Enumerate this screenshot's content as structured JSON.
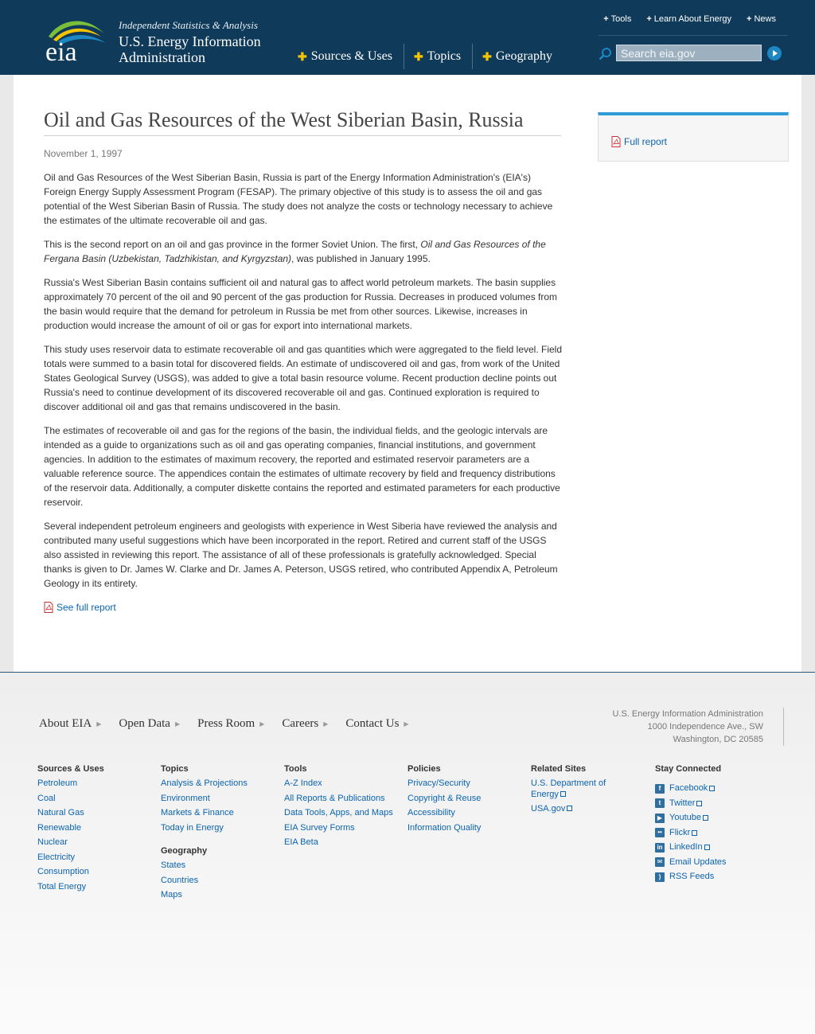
{
  "header": {
    "tagline": "Independent Statistics & Analysis",
    "org_name": "U.S. Energy Information Administration",
    "logo_text": "eia",
    "main_nav": [
      "Sources & Uses",
      "Topics",
      "Geography"
    ],
    "util_nav": [
      "Tools",
      "Learn About Energy",
      "News"
    ],
    "search_placeholder": "Search eia.gov"
  },
  "article": {
    "title": "Oil and Gas Resources of the West Siberian Basin, Russia",
    "date": "November 1, 1997",
    "p1": "Oil and Gas Resources of the West Siberian Basin, Russia is part of the Energy Information Administration's (EIA's) Foreign Energy Supply Assessment Program (FESAP). The primary objective of this study is to assess the oil and gas potential of the West Siberian Basin of Russia. The study does not analyze the costs or technology necessary to achieve the estimates of the ultimate recoverable oil and gas.",
    "p2_a": "This is the second report on an oil and gas province in the former Soviet Union. The first, ",
    "p2_em": "Oil and Gas Resources of the Fergana Basin (Uzbekistan, Tadzhikistan, and Kyrgyzstan)",
    "p2_b": ", was published in January 1995.",
    "p3": "Russia's West Siberian Basin contains sufficient oil and natural gas to affect world petroleum markets. The basin supplies approximately 70 percent of the oil and 90 percent of the gas production for Russia. Decreases in produced volumes from the basin would require that the demand for petroleum in Russia be met from other sources. Likewise, increases in production would increase the amount of oil or gas for export into international markets.",
    "p4": "This study uses reservoir data to estimate recoverable oil and gas quantities which were aggregated to the field level. Field totals were summed to a basin total for discovered fields. An estimate of undiscovered oil and gas, from work of the United States Geological Survey (USGS), was added to give a total basin resource volume. Recent production decline points out Russia's need to continue development of its discovered recoverable oil and gas. Continued exploration is required to discover additional oil and gas that remains undiscovered in the basin.",
    "p5": "The estimates of recoverable oil and gas for the regions of the basin, the individual fields, and the geologic intervals are intended as a guide to organizations such as oil and gas operating companies, financial institutions, and government agencies. In addition to the estimates of maximum recovery, the reported and estimated reservoir parameters are a valuable reference source. The appendices contain the estimates of ultimate recovery by field and frequency distributions of the reservoir data. Additionally, a computer diskette contains the reported and estimated parameters for each productive reservoir.",
    "p6": "Several independent petroleum engineers and geologists with experience in West Siberia have reviewed the analysis and contributed many useful suggestions which have been incorporated in the report. Retired and current staff of the USGS also assisted in reviewing this report. The assistance of all of these professionals is gratefully acknowledged. Special thanks is given to Dr. James W. Clarke and Dr. James A. Peterson, USGS retired, who contributed Appendix A, Petroleum Geology in its entirety.",
    "see_full": "See full report"
  },
  "sidebar": {
    "full_report": "Full report"
  },
  "footer": {
    "nav": [
      "About EIA",
      "Open Data",
      "Press Room",
      "Careers",
      "Contact Us"
    ],
    "address": [
      "U.S. Energy Information Administration",
      "1000 Independence Ave., SW",
      "Washington, DC 20585"
    ],
    "sources_title": "Sources & Uses",
    "sources": [
      "Petroleum",
      "Coal",
      "Natural Gas",
      "Renewable",
      "Nuclear",
      "Electricity",
      "Consumption",
      "Total Energy"
    ],
    "topics_title": "Topics",
    "topics": [
      "Analysis & Projections",
      "Environment",
      "Markets & Finance",
      "Today in Energy"
    ],
    "geography_title": "Geography",
    "geography": [
      "States",
      "Countries",
      "Maps"
    ],
    "tools_title": "Tools",
    "tools": [
      "A-Z Index",
      "All Reports & Publications",
      "Data Tools, Apps, and Maps",
      "EIA Survey Forms",
      "EIA Beta"
    ],
    "policies_title": "Policies",
    "policies": [
      "Privacy/Security",
      "Copyright & Reuse",
      "Accessibility",
      "Information Quality"
    ],
    "related_title": "Related Sites",
    "related": [
      "U.S. Department of Energy",
      "USA.gov"
    ],
    "stay_title": "Stay Connected",
    "stay": [
      "Facebook",
      "Twitter",
      "Youtube",
      "Flickr",
      "LinkedIn",
      "Email Updates",
      "RSS Feeds"
    ]
  }
}
